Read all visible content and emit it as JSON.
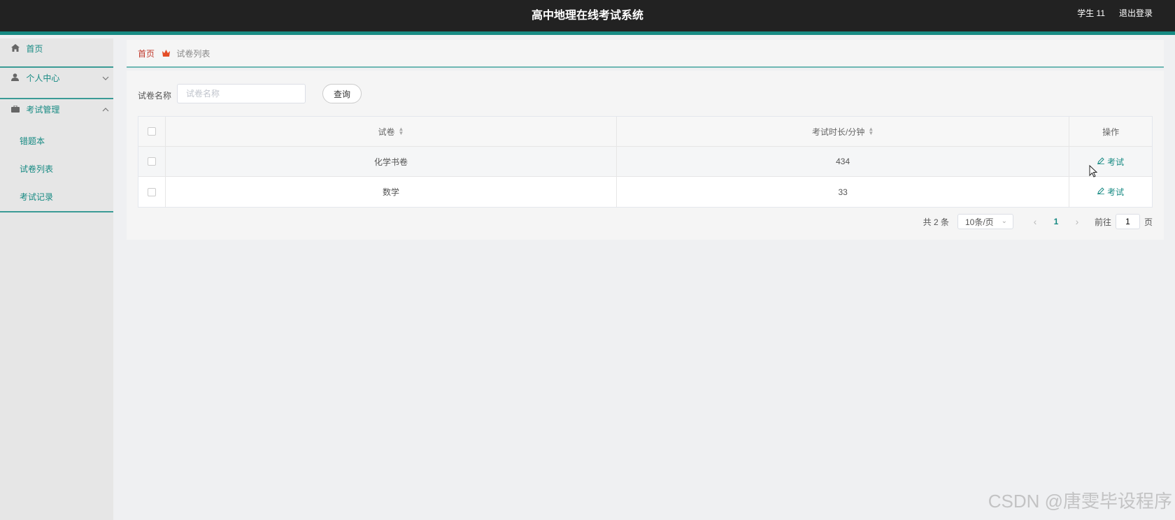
{
  "header": {
    "title": "高中地理在线考试系统",
    "user": "学生 11",
    "logout": "退出登录"
  },
  "sidebar": {
    "home": "首页",
    "personal_center": "个人中心",
    "exam_management": "考试管理",
    "sub_items": [
      "错题本",
      "试卷列表",
      "考试记录"
    ]
  },
  "breadcrumb": {
    "home": "首页",
    "current": "试卷列表"
  },
  "search": {
    "label": "试卷名称",
    "placeholder": "试卷名称",
    "button": "查询"
  },
  "table": {
    "columns": [
      "试卷",
      "考试时长/分钟",
      "操作"
    ],
    "rows": [
      {
        "name": "化学书卷",
        "duration": "434",
        "action": "考试"
      },
      {
        "name": "数学",
        "duration": "33",
        "action": "考试"
      }
    ]
  },
  "pagination": {
    "total": "共 2 条",
    "page_size": "10条/页",
    "current_page": "1",
    "goto_label": "前往",
    "goto_value": "1",
    "page_suffix": "页"
  },
  "watermark": "CSDN @唐雯毕设程序",
  "colors": {
    "header_bg": "#222222",
    "accent": "#178a83",
    "sidebar_bg": "#e6e6e6",
    "breadcrumb_home": "#c0392b"
  }
}
